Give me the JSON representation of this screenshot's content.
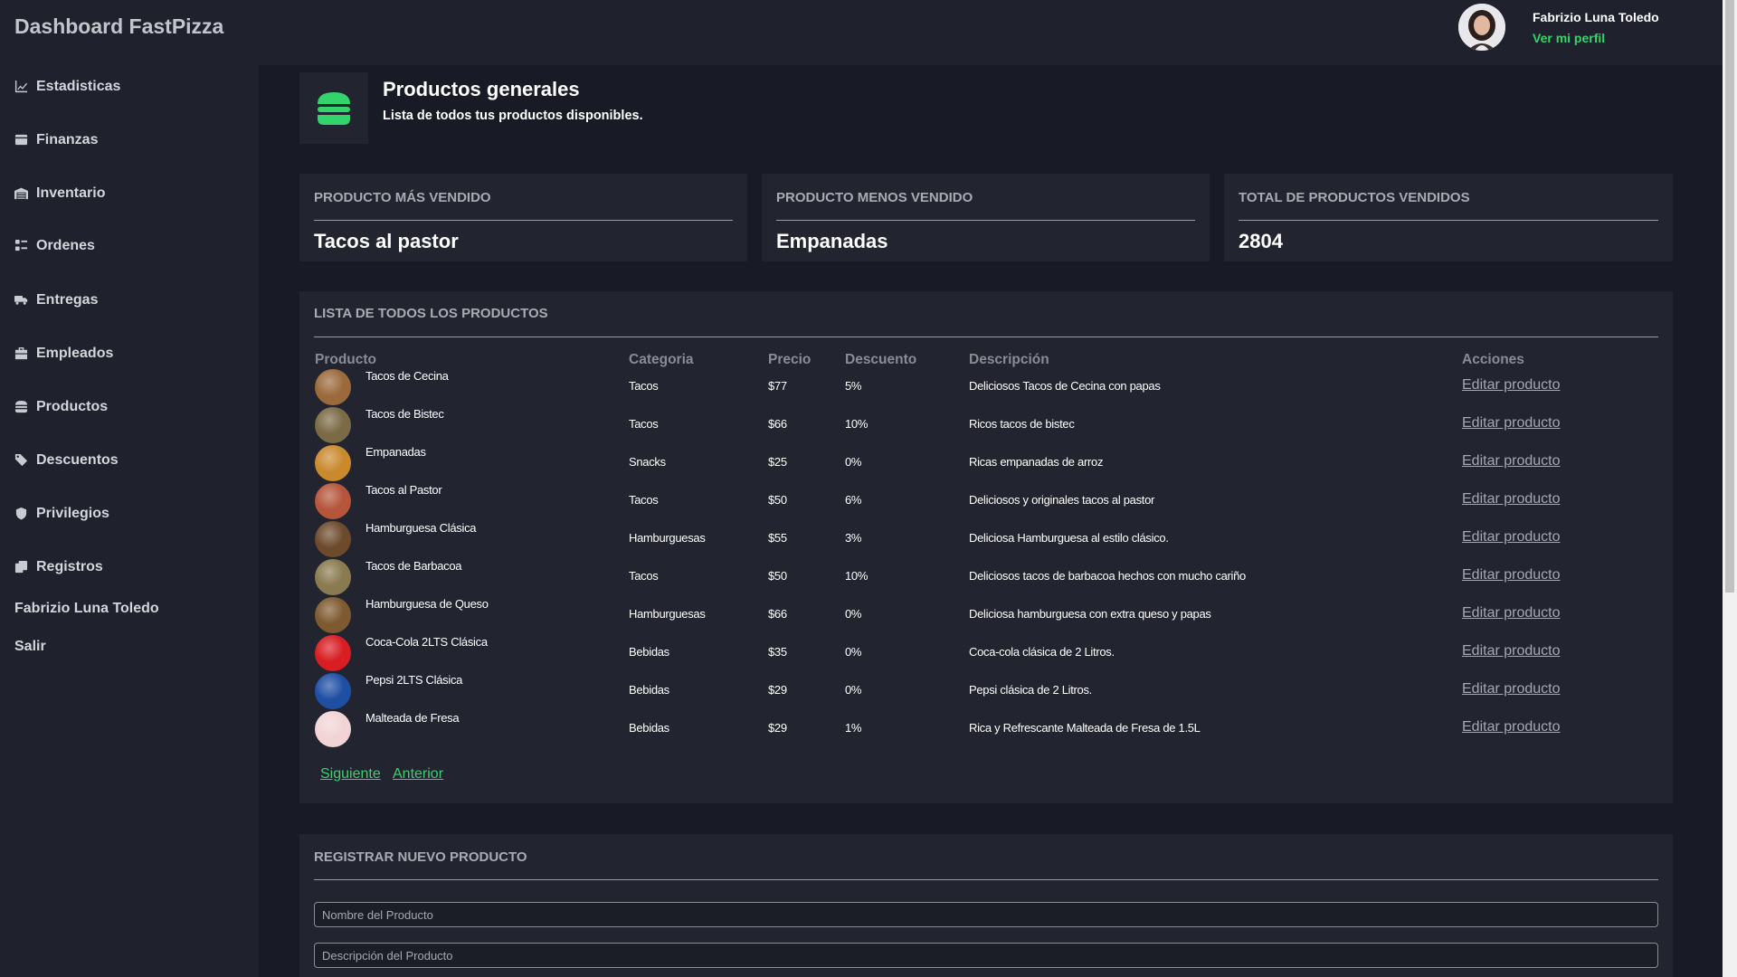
{
  "app": {
    "title": "Dashboard FastPizza"
  },
  "user": {
    "name": "Fabrizio Luna Toledo",
    "profile_link": "Ver mi perfil"
  },
  "sidebar": {
    "items": [
      {
        "label": "Estadisticas",
        "icon": "chart-line-icon"
      },
      {
        "label": "Finanzas",
        "icon": "wallet-icon"
      },
      {
        "label": "Inventario",
        "icon": "warehouse-icon"
      },
      {
        "label": "Ordenes",
        "icon": "list-check-icon"
      },
      {
        "label": "Entregas",
        "icon": "truck-icon"
      },
      {
        "label": "Empleados",
        "icon": "briefcase-icon"
      },
      {
        "label": "Productos",
        "icon": "burger-icon"
      },
      {
        "label": "Descuentos",
        "icon": "tags-icon"
      },
      {
        "label": "Privilegios",
        "icon": "shield-icon"
      },
      {
        "label": "Registros",
        "icon": "clipboard-icon"
      }
    ],
    "user_name": "Fabrizio Luna Toledo",
    "logout": "Salir"
  },
  "header": {
    "icon": "burger-icon",
    "title": "Productos generales",
    "subtitle": "Lista de todos tus productos disponibles."
  },
  "stats": [
    {
      "label": "Producto más vendido",
      "value": "Tacos al pastor"
    },
    {
      "label": "Producto menos vendido",
      "value": "Empanadas"
    },
    {
      "label": "Total de productos vendidos",
      "value": "2804"
    }
  ],
  "products_panel": {
    "title": "LISTA DE TODOS LOS PRODUCTOS",
    "columns": [
      "Producto",
      "Categoria",
      "Precio",
      "Descuento",
      "Descripción",
      "Acciones"
    ],
    "rows": [
      {
        "name": "Tacos de Cecina",
        "category": "Tacos",
        "price": "$77",
        "discount": "5%",
        "description": "Deliciosos Tacos de Cecina con papas",
        "action": "Editar producto",
        "img_color": "#9b6a3c"
      },
      {
        "name": "Tacos de Bistec",
        "category": "Tacos",
        "price": "$66",
        "discount": "10%",
        "description": "Ricos tacos de bistec",
        "action": "Editar producto",
        "img_color": "#7a6a45"
      },
      {
        "name": "Empanadas",
        "category": "Snacks",
        "price": "$25",
        "discount": "0%",
        "description": "Ricas empanadas de arroz",
        "action": "Editar producto",
        "img_color": "#c98a2e"
      },
      {
        "name": "Tacos al Pastor",
        "category": "Tacos",
        "price": "$50",
        "discount": "6%",
        "description": "Deliciosos y originales tacos al pastor",
        "action": "Editar producto",
        "img_color": "#b5553a"
      },
      {
        "name": "Hamburguesa Clásica",
        "category": "Hamburguesas",
        "price": "$55",
        "discount": "3%",
        "description": "Deliciosa Hamburguesa al estilo clásico.",
        "action": "Editar producto",
        "img_color": "#6e4a2c"
      },
      {
        "name": "Tacos de Barbacoa",
        "category": "Tacos",
        "price": "$50",
        "discount": "10%",
        "description": "Deliciosos tacos de barbacoa hechos con mucho cariño",
        "action": "Editar producto",
        "img_color": "#8a7a50"
      },
      {
        "name": "Hamburguesa de Queso",
        "category": "Hamburguesas",
        "price": "$66",
        "discount": "0%",
        "description": "Deliciosa hamburguesa con extra queso y papas",
        "action": "Editar producto",
        "img_color": "#7e5a30"
      },
      {
        "name": "Coca-Cola 2LTS Clásica",
        "category": "Bebidas",
        "price": "$35",
        "discount": "0%",
        "description": "Coca-cola clásica de 2 Litros.",
        "action": "Editar producto",
        "img_color": "#d81e22"
      },
      {
        "name": "Pepsi 2LTS Clásica",
        "category": "Bebidas",
        "price": "$29",
        "discount": "0%",
        "description": "Pepsi clásica de 2 Litros.",
        "action": "Editar producto",
        "img_color": "#1f4fa3"
      },
      {
        "name": "Malteada de Fresa",
        "category": "Bebidas",
        "price": "$29",
        "discount": "1%",
        "description": "Rica y Refrescante Malteada de Fresa de 1.5L",
        "action": "Editar producto",
        "img_color": "#f2d4d6"
      }
    ],
    "next": "Siguiente",
    "prev": "Anterior"
  },
  "register_panel": {
    "title": "REGISTRAR NUEVO PRODUCTO",
    "name_placeholder": "Nombre del Producto",
    "description_placeholder": "Descripción del Producto"
  },
  "colors": {
    "accent": "#34d46c",
    "background": "#181a25",
    "panel": "#22242f"
  }
}
